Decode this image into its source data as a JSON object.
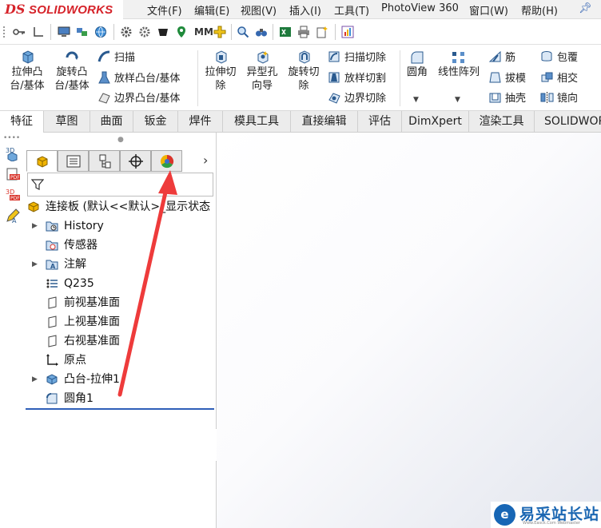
{
  "menubar": {
    "brand_mark": "DS",
    "brand_name": "SOLIDWORKS",
    "items": [
      "文件(F)",
      "编辑(E)",
      "视图(V)",
      "插入(I)",
      "工具(T)",
      "PhotoView 360",
      "窗口(W)",
      "帮助(H)"
    ]
  },
  "commands": {
    "extrude_boss": "拉伸凸\n台/基体",
    "revolve_boss": "旋转凸\n台/基体",
    "sweep": "扫描",
    "loft_boss": "放样凸台/基体",
    "boundary_boss": "边界凸台/基体",
    "extrude_cut": "拉伸切\n除",
    "hole_wizard": "异型孔\n向导",
    "revolve_cut": "旋转切\n除",
    "swept_cut": "扫描切除",
    "lofted_cut": "放样切割",
    "boundary_cut": "边界切除",
    "fillet": "圆角",
    "linear_pattern": "线性阵列",
    "rib": "筋",
    "draft": "拔模",
    "shell": "抽壳",
    "wrap": "包覆",
    "intersect": "相交",
    "mirror": "镜向"
  },
  "tabs": [
    "特征",
    "草图",
    "曲面",
    "钣金",
    "焊件",
    "模具工具",
    "直接编辑",
    "评估",
    "DimXpert",
    "渲染工具",
    "SOLIDWORKS"
  ],
  "active_tab": "特征",
  "tree": {
    "root": "连接板 (默认<<默认>_显示状态",
    "items": [
      {
        "label": "History",
        "expandable": true,
        "icon": "folder-history-icon"
      },
      {
        "label": "传感器",
        "expandable": false,
        "icon": "sensor-icon"
      },
      {
        "label": "注解",
        "expandable": true,
        "icon": "annotation-icon"
      },
      {
        "label": "Q235",
        "expandable": false,
        "icon": "material-icon"
      },
      {
        "label": "前视基准面",
        "expandable": false,
        "icon": "plane-icon"
      },
      {
        "label": "上视基准面",
        "expandable": false,
        "icon": "plane-icon"
      },
      {
        "label": "右视基准面",
        "expandable": false,
        "icon": "plane-icon"
      },
      {
        "label": "原点",
        "expandable": false,
        "icon": "origin-icon"
      },
      {
        "label": "凸台-拉伸1",
        "expandable": true,
        "icon": "extrude-feature-icon"
      },
      {
        "label": "圆角1",
        "expandable": false,
        "icon": "fillet-feature-icon"
      }
    ]
  },
  "watermark": {
    "mark": "e",
    "text": "易采站长站",
    "sub": "Www.Easck.Com Webmaster"
  },
  "colors": {
    "brand_red": "#d6232a",
    "annotation_arrow": "#ee3b3b",
    "selection_bar": "#2f5fb8"
  }
}
